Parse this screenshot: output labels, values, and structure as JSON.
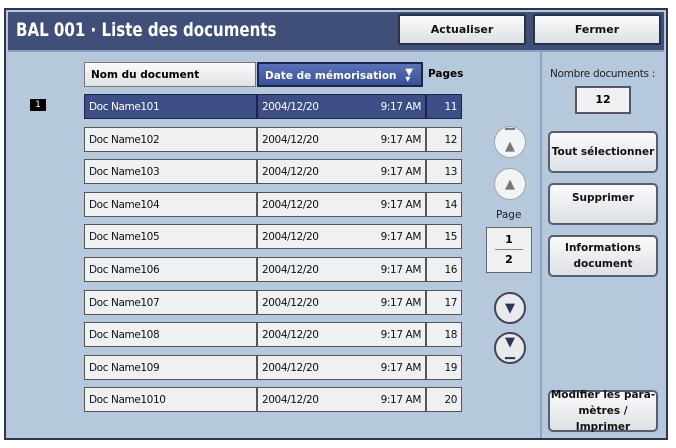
{
  "title": "BAL 001 · Liste des documents",
  "buttons": {
    "refresh": "Actualiser",
    "close": "Fermer",
    "select_all": "Tout sélectionner",
    "delete": "Supprimer",
    "doc_info_1": "Informations",
    "doc_info_2": "document",
    "modify_1": "Modifier les para-",
    "modify_2": "mètres / Imprimer"
  },
  "columns": {
    "name": "Nom du document",
    "date": "Date de mémorisation",
    "pages": "Pages"
  },
  "selected_index": "1",
  "rows": [
    {
      "name": "Doc Name101",
      "date": "2004/12/20",
      "time": "9:17 AM",
      "pages": "11"
    },
    {
      "name": "Doc Name102",
      "date": "2004/12/20",
      "time": "9:17 AM",
      "pages": "12"
    },
    {
      "name": "Doc Name103",
      "date": "2004/12/20",
      "time": "9:17 AM",
      "pages": "13"
    },
    {
      "name": "Doc Name104",
      "date": "2004/12/20",
      "time": "9:17 AM",
      "pages": "14"
    },
    {
      "name": "Doc Name105",
      "date": "2004/12/20",
      "time": "9:17 AM",
      "pages": "15"
    },
    {
      "name": "Doc Name106",
      "date": "2004/12/20",
      "time": "9:17 AM",
      "pages": "16"
    },
    {
      "name": "Doc Name107",
      "date": "2004/12/20",
      "time": "9:17 AM",
      "pages": "17"
    },
    {
      "name": "Doc Name108",
      "date": "2004/12/20",
      "time": "9:17 AM",
      "pages": "18"
    },
    {
      "name": "Doc Name109",
      "date": "2004/12/20",
      "time": "9:17 AM",
      "pages": "19"
    },
    {
      "name": "Doc Name1010",
      "date": "2004/12/20",
      "time": "9:17 AM",
      "pages": "20"
    }
  ],
  "pager": {
    "label": "Page",
    "current": "1",
    "total": "2"
  },
  "count": {
    "label": "Nombre documents :",
    "value": "12"
  }
}
